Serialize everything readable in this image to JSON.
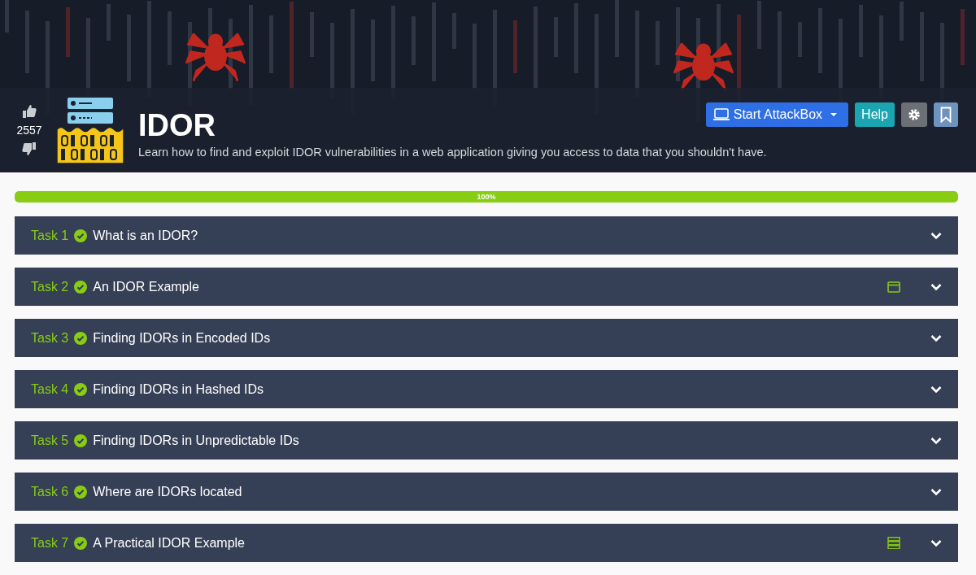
{
  "room": {
    "votes": "2557",
    "title": "IDOR",
    "description": "Learn how to find and exploit IDOR vulnerabilities in a web application giving you access to data that you shouldn't have."
  },
  "actions": {
    "attackbox": "Start AttackBox",
    "help": "Help"
  },
  "progress": {
    "level": 1,
    "label": "100%"
  },
  "tasks": [
    {
      "number": "Task 1",
      "title": "What is an IDOR?",
      "done": true,
      "kind": "plain"
    },
    {
      "number": "Task 2",
      "title": "An IDOR Example",
      "done": true,
      "kind": "window"
    },
    {
      "number": "Task 3",
      "title": "Finding IDORs in Encoded IDs",
      "done": true,
      "kind": "plain"
    },
    {
      "number": "Task 4",
      "title": "Finding IDORs in Hashed IDs",
      "done": true,
      "kind": "plain"
    },
    {
      "number": "Task 5",
      "title": "Finding IDORs in Unpredictable IDs",
      "done": true,
      "kind": "plain"
    },
    {
      "number": "Task 6",
      "title": "Where are IDORs located",
      "done": true,
      "kind": "plain"
    },
    {
      "number": "Task 7",
      "title": "A Practical IDOR Example",
      "done": true,
      "kind": "server"
    }
  ]
}
